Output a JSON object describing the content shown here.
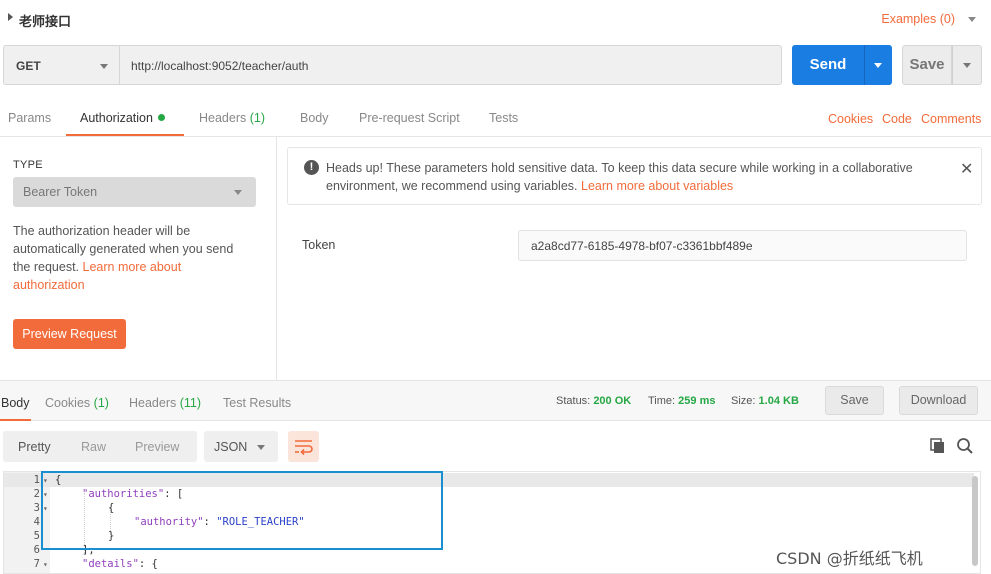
{
  "title": "老师接口",
  "examples": "Examples (0)",
  "request": {
    "method": "GET",
    "url": "http://localhost:9052/teacher/auth",
    "send": "Send",
    "save": "Save"
  },
  "req_tabs": {
    "params": "Params",
    "authorization": "Authorization",
    "headers": "Headers",
    "headers_count": "(1)",
    "body": "Body",
    "prerequest": "Pre-request Script",
    "tests": "Tests",
    "cookies": "Cookies",
    "code": "Code",
    "comments": "Comments"
  },
  "auth": {
    "type_label": "TYPE",
    "type_value": "Bearer Token",
    "desc_1": "The authorization header will be",
    "desc_2": "automatically generated when you send",
    "desc_3": "the request.",
    "desc_link_1": "Learn more about",
    "desc_link_2": "authorization",
    "preview_button": "Preview Request",
    "alert_1": "Heads up! These parameters hold sensitive data. To keep this data secure while working in a collaborative",
    "alert_2": "environment, we recommend using variables.",
    "alert_link": "Learn more about variables",
    "token_label": "Token",
    "token_value": "a2a8cd77-6185-4978-bf07-c3361bbf489e"
  },
  "response": {
    "tabs": {
      "body": "Body",
      "cookies": "Cookies",
      "cookies_count": "(1)",
      "headers": "Headers",
      "headers_count": "(11)",
      "test_results": "Test Results"
    },
    "status_label": "Status:",
    "status_value": "200 OK",
    "time_label": "Time:",
    "time_value": "259 ms",
    "size_label": "Size:",
    "size_value": "1.04 KB",
    "save": "Save",
    "download": "Download",
    "view_modes": [
      "Pretty",
      "Raw",
      "Preview"
    ],
    "format": "JSON"
  },
  "code_lines": [
    {
      "n": "1",
      "text": "{"
    },
    {
      "n": "2",
      "key": "\"authorities\"",
      "rest": ": ["
    },
    {
      "n": "3",
      "text": "{"
    },
    {
      "n": "4",
      "key": "\"authority\"",
      "rest": ": ",
      "str": "\"ROLE_TEACHER\""
    },
    {
      "n": "5",
      "text": "}"
    },
    {
      "n": "6",
      "text": "],"
    },
    {
      "n": "7",
      "key": "\"details\"",
      "rest": ": {"
    }
  ],
  "watermark": "CSDN @折纸纸飞机",
  "colors": {
    "accent": "#f26b3a",
    "primary": "#1a7de2",
    "success": "#25a744",
    "selection_box": "#1a8fcf"
  }
}
